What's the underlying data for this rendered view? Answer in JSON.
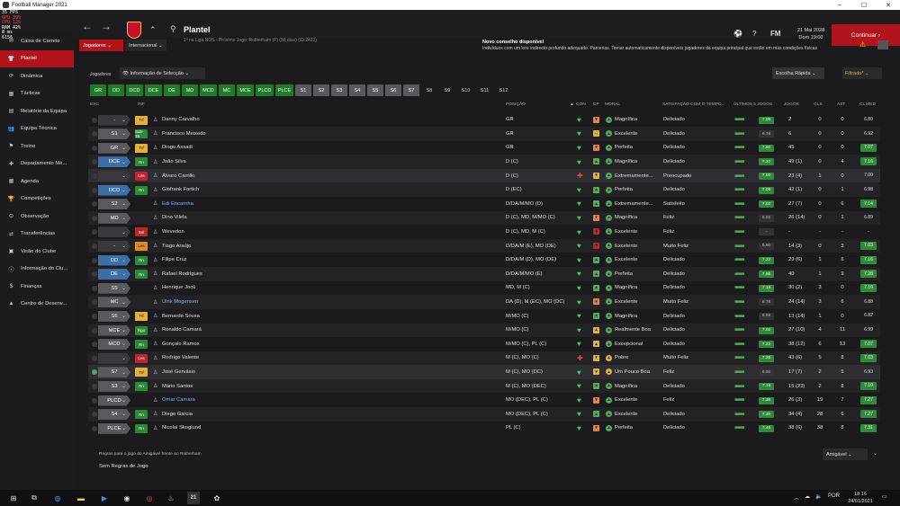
{
  "window": {
    "title": "Football Manager 2021"
  },
  "fps": {
    "lines": [
      "35 FPS",
      "GPU 39%",
      "CPU 12%",
      "RAM 42%",
      "8 ms",
      "6156"
    ]
  },
  "header": {
    "title": "Plantel",
    "subtitle": "1º na Liga NOS - Próximo Jogo: Rotherham (F) (58 dias) (ID:2422)",
    "date": "21 Mai 2028",
    "day_time": "Dom 19:00",
    "continue_label": "Continuar"
  },
  "sidebar": {
    "items": [
      {
        "label": "Caixa de Correio",
        "icon": "mail-icon",
        "active": false
      },
      {
        "label": "Plantel",
        "icon": "squad-icon",
        "active": true
      },
      {
        "label": "Dinâmica",
        "icon": "dynamics-icon",
        "active": false
      },
      {
        "label": "Tácticas",
        "icon": "tactics-icon",
        "active": false
      },
      {
        "label": "Relatório da Equipa",
        "icon": "report-icon",
        "active": false
      },
      {
        "label": "Equipa Técnica",
        "icon": "staff-icon",
        "active": false
      },
      {
        "label": "Treino",
        "icon": "training-icon",
        "active": false
      },
      {
        "label": "Departamento Mé...",
        "icon": "medical-icon",
        "active": false
      },
      {
        "label": "Agenda",
        "icon": "calendar-icon",
        "active": false
      },
      {
        "label": "Competições",
        "icon": "trophy-icon",
        "active": false
      },
      {
        "label": "Observação",
        "icon": "scouting-icon",
        "active": false
      },
      {
        "label": "Transferências",
        "icon": "transfer-icon",
        "active": false
      },
      {
        "label": "Visão do Clube",
        "icon": "club-icon",
        "active": false
      },
      {
        "label": "Informação do Clu...",
        "icon": "info-icon",
        "active": false
      },
      {
        "label": "Finanças",
        "icon": "finance-icon",
        "active": false
      },
      {
        "label": "Centro de Desenv...",
        "icon": "development-icon",
        "active": false
      }
    ]
  },
  "subnav": {
    "players_label": "Jogadores",
    "intl_label": "Internacional"
  },
  "advice": {
    "title": "Novo conselho disponível",
    "text": "Indivíduos com um lore indirecto profundo adequado. Parcerias. Tomar automaticamente disponíveis jogadores da equipa principal que estão em más condições físicas"
  },
  "filters": {
    "players_label": "Jogadores",
    "selection_view": "Informação de Selecção",
    "quick_pick": "Escolha Rápida",
    "filtered": "Filtrado*"
  },
  "positions": [
    {
      "label": "GR",
      "style": "g"
    },
    {
      "label": "DD",
      "style": "g"
    },
    {
      "label": "DCD",
      "style": "g"
    },
    {
      "label": "DCE",
      "style": "g"
    },
    {
      "label": "DE",
      "style": "g"
    },
    {
      "label": "MD",
      "style": "g"
    },
    {
      "label": "MCD",
      "style": "g"
    },
    {
      "label": "MC",
      "style": "g"
    },
    {
      "label": "MCE",
      "style": "g"
    },
    {
      "label": "PLCD",
      "style": "g"
    },
    {
      "label": "PLCE",
      "style": "g"
    },
    {
      "label": "S1",
      "style": "s"
    },
    {
      "label": "S2",
      "style": "s"
    },
    {
      "label": "S3",
      "style": "s"
    },
    {
      "label": "S4",
      "style": "s"
    },
    {
      "label": "S5",
      "style": "s"
    },
    {
      "label": "S6",
      "style": "s"
    },
    {
      "label": "S7",
      "style": "s"
    },
    {
      "label": "S8",
      "style": "n"
    },
    {
      "label": "S9",
      "style": "n"
    },
    {
      "label": "S10",
      "style": "n"
    },
    {
      "label": "S11",
      "style": "n"
    },
    {
      "label": "S12",
      "style": "n"
    }
  ],
  "columns": {
    "esc": "ESC",
    "inf": "INF",
    "name": "",
    "pos": "POSIÇÃO",
    "con": "CON",
    "cp": "CP",
    "moral": "MORAL",
    "sat": "SATISFAÇÃO COM O TEMPO...",
    "form": "ÚLTIMOS 5 JOGOS",
    "games": "JOGOS",
    "goals": "GLS",
    "assists": "AST",
    "avg": "CL MED"
  },
  "players": [
    {
      "sel": "-",
      "selstyle": "none",
      "inf": "Trf",
      "infstyle": "y",
      "name": "Danny Carvalho",
      "link": false,
      "pos": "GR",
      "con": "♥",
      "cpc": "#e8823a",
      "cp": "▾",
      "morc": "#4caf50",
      "moral": "Magnífica",
      "sat": "Deliciado",
      "avg": "7.06",
      "avgstyle": "g",
      "games": "2",
      "goals": "0",
      "assists": "0",
      "clmed": "6.80",
      "clstyle": "d"
    },
    {
      "sel": "S1",
      "selstyle": "gray",
      "inf": "Sub-19",
      "infstyle": "g",
      "name": "Francisco Meixedo",
      "link": false,
      "pos": "GR",
      "con": "♥",
      "cpc": "#e4b13a",
      "cp": "–",
      "morc": "#4caf50",
      "moral": "Excelente",
      "sat": "Deliciado",
      "avg": "6.78",
      "avgstyle": "d",
      "games": "6",
      "goals": "0",
      "assists": "0",
      "clmed": "6.92",
      "clstyle": "d"
    },
    {
      "sel": "GR",
      "selstyle": "gray",
      "inf": "Trf",
      "infstyle": "y",
      "name": "Diogo Assadi",
      "link": false,
      "pos": "GR",
      "con": "♥",
      "cpc": "#e8823a",
      "cp": "▾",
      "morc": "#4caf50",
      "moral": "Perfeita",
      "sat": "Deliciado",
      "avg": "7.60",
      "avgstyle": "g",
      "games": "45",
      "goals": "0",
      "assists": "0",
      "clmed": "7.07",
      "clstyle": "g"
    },
    {
      "sel": "DCE",
      "selstyle": "blue",
      "inf": "Rn",
      "infstyle": "g",
      "name": "João Silva",
      "link": false,
      "pos": "D (C)",
      "con": "♥",
      "cpc": "#4caf50",
      "cp": "▴",
      "morc": "#4caf50",
      "moral": "Magnífica",
      "sat": "Deliciado",
      "avg": "7.22",
      "avgstyle": "g",
      "games": "49 (1)",
      "goals": "0",
      "assists": "4",
      "clmed": "7.16",
      "clstyle": "g"
    },
    {
      "sel": "",
      "selstyle": "none",
      "inf": "Les",
      "infstyle": "r",
      "name": "Álvaro Carrillo",
      "link": false,
      "pos": "D (C)",
      "con": "✚",
      "cpc": "#e4b13a",
      "cp": "▾",
      "morc": "#4caf50",
      "moral": "Extremamente...",
      "sat": "Preocupado",
      "avg": "7.00",
      "avgstyle": "g",
      "games": "23 (4)",
      "goals": "1",
      "assists": "0",
      "clmed": "7.00",
      "clstyle": "d"
    },
    {
      "sel": "DCD",
      "selstyle": "blue",
      "inf": "Rn",
      "infstyle": "g",
      "name": "Giofrank Fortich",
      "link": false,
      "pos": "D (EC)",
      "con": "♥",
      "cpc": "#4caf50",
      "cp": "▴",
      "morc": "#4caf50",
      "moral": "Perfeita",
      "sat": "Deliciado",
      "avg": "7.06",
      "avgstyle": "g",
      "games": "42 (1)",
      "goals": "0",
      "assists": "1",
      "clmed": "6.98",
      "clstyle": "d"
    },
    {
      "sel": "S2",
      "selstyle": "gray",
      "inf": "",
      "infstyle": "x",
      "name": "Edi Encarnha",
      "link": true,
      "pos": "D/DA/M/MO (D)",
      "con": "♥",
      "cpc": "#4caf50",
      "cp": "▴",
      "morc": "#4caf50",
      "moral": "Extremamente...",
      "sat": "Satisfeito",
      "avg": "7.02",
      "avgstyle": "g",
      "games": "27 (7)",
      "goals": "0",
      "assists": "6",
      "clmed": "7.14",
      "clstyle": "g"
    },
    {
      "sel": "MD",
      "selstyle": "gray",
      "inf": "",
      "infstyle": "x",
      "name": "Dino Vilela",
      "link": false,
      "pos": "D (C), MD, M/MO (C)",
      "con": "♥",
      "cpc": "#e8823a",
      "cp": "▾",
      "morc": "#4caf50",
      "moral": "Magnífica",
      "sat": "Feliz",
      "avg": "6.92",
      "avgstyle": "d",
      "games": "26 (14)",
      "goals": "0",
      "assists": "1",
      "clmed": "6.89",
      "clstyle": "d"
    },
    {
      "sel": "",
      "selstyle": "none",
      "inf": "Sel",
      "infstyle": "r",
      "name": "Weverton",
      "link": false,
      "pos": "D (C), MD, M (C)",
      "con": "♥",
      "cpc": "#c0242c",
      "cp": "▾",
      "morc": "#4caf50",
      "moral": "Excelente",
      "sat": "Feliz",
      "avg": "-",
      "avgstyle": "d",
      "games": "-",
      "goals": "-",
      "assists": "-",
      "clmed": "-",
      "clstyle": "d"
    },
    {
      "sel": "-",
      "selstyle": "none",
      "inf": "Les",
      "infstyle": "o",
      "name": "Tiago Araújo",
      "link": false,
      "pos": "D/DA/M (E), MO (DE)",
      "con": "♥",
      "cpc": "#c0242c",
      "cp": "▾",
      "morc": "#4caf50",
      "moral": "Excelente",
      "sat": "Muito Feliz",
      "avg": "6.90",
      "avgstyle": "d",
      "games": "14 (3)",
      "goals": "0",
      "assists": "3",
      "clmed": "7.03",
      "clstyle": "g"
    },
    {
      "sel": "DD",
      "selstyle": "blue",
      "inf": "Rn",
      "infstyle": "g",
      "name": "Filipe Cruz",
      "link": false,
      "pos": "D/DA/M (D), MO (DE)",
      "con": "♥",
      "cpc": "#4caf50",
      "cp": "▴",
      "morc": "#4caf50",
      "moral": "Excelente",
      "sat": "Deliciado",
      "avg": "7.22",
      "avgstyle": "g",
      "games": "29 (6)",
      "goals": "1",
      "assists": "6",
      "clmed": "7.16",
      "clstyle": "g"
    },
    {
      "sel": "DE",
      "selstyle": "blue",
      "inf": "Rn",
      "infstyle": "g",
      "name": "Rafael Rodrigues",
      "link": false,
      "pos": "D/DA/M/MO (E)",
      "con": "♥",
      "cpc": "#4caf50",
      "cp": "▴",
      "morc": "#4caf50",
      "moral": "Perfeita",
      "sat": "Deliciado",
      "avg": "7.56",
      "avgstyle": "g",
      "games": "40",
      "goals": "1",
      "assists": "9",
      "clmed": "7.28",
      "clstyle": "g"
    },
    {
      "sel": "S5",
      "selstyle": "gray",
      "inf": "",
      "infstyle": "x",
      "name": "Henrique Jocú",
      "link": false,
      "pos": "MD, M (C)",
      "con": "♥",
      "cpc": "#4caf50",
      "cp": "▴",
      "morc": "#4caf50",
      "moral": "Magnífica",
      "sat": "Deliciado",
      "avg": "7.18",
      "avgstyle": "g",
      "games": "30 (2)",
      "goals": "3",
      "assists": "0",
      "clmed": "7.10",
      "clstyle": "g"
    },
    {
      "sel": "MC",
      "selstyle": "gray",
      "inf": "",
      "infstyle": "x",
      "name": "Ulrik Mogensen",
      "link": true,
      "pos": "DA (D), M (EC), MO (DC)",
      "con": "♥",
      "cpc": "#e8823a",
      "cp": "▾",
      "morc": "#4caf50",
      "moral": "Excelente",
      "sat": "Muito Feliz",
      "avg": "6.78",
      "avgstyle": "d",
      "games": "24 (14)",
      "goals": "3",
      "assists": "6",
      "clmed": "6.88",
      "clstyle": "d"
    },
    {
      "sel": "S6",
      "selstyle": "gray",
      "inf": "Trf",
      "infstyle": "y",
      "name": "Bernardo Sousa",
      "link": false,
      "pos": "M/MO (C)",
      "con": "♥",
      "cpc": "#4caf50",
      "cp": "▴",
      "morc": "#4caf50",
      "moral": "Magnífica",
      "sat": "Deliciado",
      "avg": "6.68",
      "avgstyle": "d",
      "games": "13 (14)",
      "goals": "1",
      "assists": "0",
      "clmed": "6.82",
      "clstyle": "d"
    },
    {
      "sel": "MCE",
      "selstyle": "gray",
      "inf": "Rgo",
      "infstyle": "g",
      "name": "Ronaldo Camará",
      "link": false,
      "pos": "M/MO (C)",
      "con": "♥",
      "cpc": "#e4b13a",
      "cp": "▴",
      "morc": "#4caf50",
      "moral": "Realmente Boa",
      "sat": "Deliciado",
      "avg": "7.02",
      "avgstyle": "g",
      "games": "27 (10)",
      "goals": "4",
      "assists": "11",
      "clmed": "6.99",
      "clstyle": "d"
    },
    {
      "sel": "MCD",
      "selstyle": "gray",
      "inf": "Rn",
      "infstyle": "g",
      "name": "Gonçalo Ramos",
      "link": false,
      "pos": "M/MO (C), PL (C)",
      "con": "♥",
      "cpc": "#e4b13a",
      "cp": "▴",
      "morc": "#4caf50",
      "moral": "Excepcional",
      "sat": "Deliciado",
      "avg": "7.22",
      "avgstyle": "g",
      "games": "38 (12)",
      "goals": "6",
      "assists": "13",
      "clmed": "7.07",
      "clstyle": "g"
    },
    {
      "sel": "",
      "selstyle": "none",
      "inf": "Les",
      "infstyle": "r",
      "name": "Rodrigo Valente",
      "link": false,
      "pos": "M (C), MO (C)",
      "con": "✚",
      "cpc": "#e4b13a",
      "cp": "▾",
      "morc": "#e4b13a",
      "moral": "Pobre",
      "sat": "Muito Feliz",
      "avg": "7.26",
      "avgstyle": "g",
      "games": "43 (6)",
      "goals": "5",
      "assists": "8",
      "clmed": "7.03",
      "clstyle": "g"
    },
    {
      "sel": "S7",
      "selstyle": "gray",
      "inf": "Trf",
      "infstyle": "y",
      "name": "José Gervásio",
      "link": false,
      "pos": "M (C), MO (DC)",
      "con": "♥",
      "cpc": "#e4b13a",
      "cp": "▾",
      "morc": "#e4b13a",
      "moral": "Um Pouco Boa",
      "sat": "Feliz",
      "avg": "6.84",
      "avgstyle": "d",
      "games": "17 (7)",
      "goals": "2",
      "assists": "5",
      "clmed": "6.93",
      "clstyle": "d"
    },
    {
      "sel": "S3",
      "selstyle": "gray",
      "inf": "Rn",
      "infstyle": "g",
      "name": "Mário Santos",
      "link": false,
      "pos": "M (C), MO (DEC)",
      "con": "♥",
      "cpc": "#4caf50",
      "cp": "▴",
      "morc": "#4caf50",
      "moral": "Magnífica",
      "sat": "Deliciado",
      "avg": "7.16",
      "avgstyle": "g",
      "games": "15 (23)",
      "goals": "2",
      "assists": "8",
      "clmed": "7.10",
      "clstyle": "g"
    },
    {
      "sel": "PLCD",
      "selstyle": "gray",
      "inf": "",
      "infstyle": "x",
      "name": "Omar Camara",
      "link": true,
      "pos": "MO (DEC), PL (C)",
      "con": "♥",
      "cpc": "#e8823a",
      "cp": "▾",
      "morc": "#4caf50",
      "moral": "Excelente",
      "sat": "Feliz",
      "avg": "7.38",
      "avgstyle": "g",
      "games": "26 (3)",
      "goals": "19",
      "assists": "7",
      "clmed": "7.27",
      "clstyle": "g"
    },
    {
      "sel": "S4",
      "selstyle": "gray",
      "inf": "Rn",
      "infstyle": "g",
      "name": "Diego Garcia",
      "link": false,
      "pos": "MO (DEC), PL (C)",
      "con": "♥",
      "cpc": "#4caf50",
      "cp": "▴",
      "morc": "#4caf50",
      "moral": "Excelente",
      "sat": "Deliciado",
      "avg": "7.30",
      "avgstyle": "g",
      "games": "34 (4)",
      "goals": "28",
      "assists": "6",
      "clmed": "7.27",
      "clstyle": "g"
    },
    {
      "sel": "PLCE",
      "selstyle": "gray",
      "inf": "Rn",
      "infstyle": "g",
      "name": "Nicolai Skoglund",
      "link": false,
      "pos": "PL (C)",
      "con": "♥",
      "cpc": "#e8823a",
      "cp": "▾",
      "morc": "#4caf50",
      "moral": "Perfeita",
      "sat": "Deliciado",
      "avg": "7.46",
      "avgstyle": "g",
      "games": "38 (6)",
      "goals": "38",
      "assists": "8",
      "clmed": "7.31",
      "clstyle": "g"
    }
  ],
  "footer": {
    "rules_title": "Regras para o jogo do Amigável frente ao Rotherham",
    "rules_value": "Sem Regras de Jogo",
    "match_type": "Amigável"
  },
  "taskbar": {
    "lang": "POR",
    "time": "18:16",
    "date": "24/01/2021"
  }
}
